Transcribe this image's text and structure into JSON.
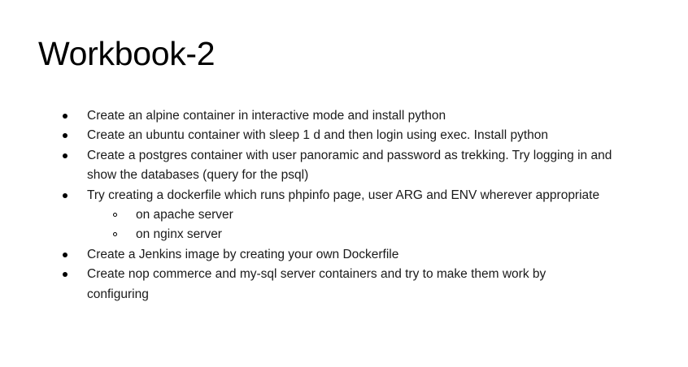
{
  "title": "Workbook-2",
  "tasks": [
    {
      "text": "Create an alpine container in interactive mode and install python"
    },
    {
      "text": "Create an ubuntu container with sleep 1 d and then login using exec. Install python"
    },
    {
      "text": "Create a postgres container with user panoramic and password as trekking. Try logging in and show the databases (query for the psql)"
    },
    {
      "text": "Try creating a dockerfile which runs phpinfo page, user ARG and ENV wherever appropriate",
      "subitems": [
        {
          "text": "on apache server"
        },
        {
          "text": "on nginx server"
        }
      ]
    },
    {
      "text": "Create a Jenkins image by creating your own Dockerfile"
    },
    {
      "text": "Create nop commerce and my-sql server containers and try to make them work by configuring"
    }
  ]
}
